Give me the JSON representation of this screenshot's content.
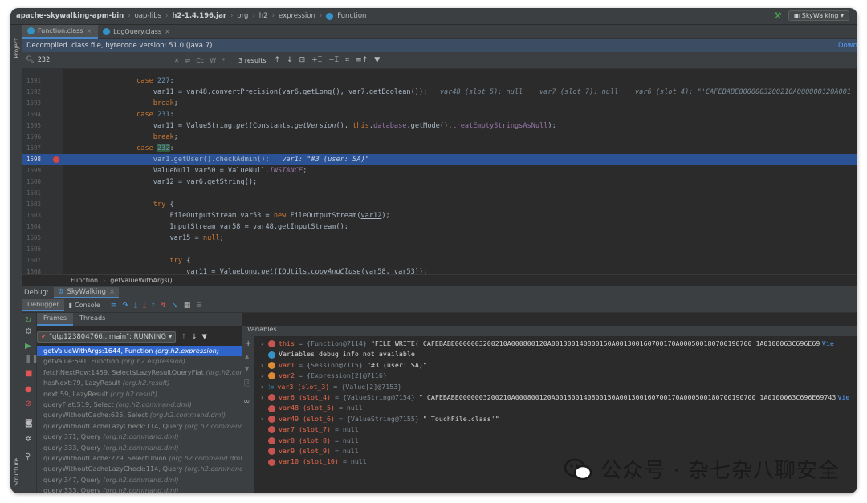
{
  "breadcrumb": [
    "apache-skywalking-apm-bin",
    "oap-libs",
    "h2-1.4.196.jar",
    "org",
    "h2",
    "expression",
    "Function"
  ],
  "run_config": "SkyWalking",
  "left_strip": {
    "project": "Project",
    "structure": "Structure"
  },
  "editor_tabs": [
    {
      "label": "Function.class",
      "active": true
    },
    {
      "label": "LogQuery.class",
      "active": false
    }
  ],
  "decompiled_notice": "Decompiled .class file, bytecode version: 51.0 (Java 7)",
  "decompiled_link": "Down",
  "find": {
    "query": "232",
    "results": "3 results",
    "opts": [
      "Cc",
      "W",
      "*"
    ]
  },
  "code": [
    {
      "ln": "1591",
      "html": "            <span class='k'>case</span> <span class='n'>227</span>:"
    },
    {
      "ln": "1592",
      "html": "                var11 = var48.<span>convertPrecision</span>(<span class='u'>var6</span>.getLong(), var7.getBoolean());   <span class='dbg'>var48 (slot_5): null    var7 (slot_7): null    var6 (slot_4): \"'CAFEBABE0000003200210A000800120A001</span>"
    },
    {
      "ln": "1593",
      "html": "                <span class='k'>break</span>;"
    },
    {
      "ln": "1594",
      "html": "            <span class='k'>case</span> <span class='n'>231</span>:"
    },
    {
      "ln": "1595",
      "html": "                var11 = ValueString.<span class='it'>get</span>(Constants.<span class='it'>getVersion</span>(), <span class='k'>this</span>.<span class='f'>database</span>.getMode().<span class='f'>treatEmptyStringsAsNull</span>);"
    },
    {
      "ln": "1596",
      "html": "                <span class='k'>break</span>;"
    },
    {
      "ln": "1597",
      "html": "            <span class='k'>case</span> <span class='n' style='background:#32593d'>232</span>:"
    },
    {
      "ln": "1598",
      "hl": true,
      "bp": true,
      "html": "                var1.getUser().checkAdmin();   <span class='dbg' style='color:#c5d2e0'>var1: \"#3 (user: SA)\"</span>"
    },
    {
      "ln": "1599",
      "html": "                ValueNull var50 = ValueNull.<span class='f it'>INSTANCE</span>;"
    },
    {
      "ln": "1600",
      "html": "                <span class='u'>var12</span> = <span class='u'>var6</span>.getString();"
    },
    {
      "ln": "1601",
      "html": ""
    },
    {
      "ln": "1602",
      "html": "                <span class='k'>try</span> {"
    },
    {
      "ln": "1603",
      "html": "                    FileOutputStream var53 = <span class='k'>new</span> FileOutputStream(<span class='u'>var12</span>);"
    },
    {
      "ln": "1604",
      "html": "                    InputStream var58 = var48.getInputStream();"
    },
    {
      "ln": "1605",
      "html": "                    <span class='u'>var15</span> = <span class='k'>null</span>;"
    },
    {
      "ln": "1606",
      "html": ""
    },
    {
      "ln": "1607",
      "html": "                    <span class='k'>try</span> {"
    },
    {
      "ln": "1608",
      "html": "                        var11 = ValueLong.<span class='it'>get</span>(IOUtils.<span class='it'>copyAndClose</span>(var58, var53));"
    }
  ],
  "code_crumbs": [
    "Function",
    "getValueWithArgs()"
  ],
  "debug": {
    "label": "Debug:",
    "session": "SkyWalking",
    "tabs": [
      "Debugger",
      "Console"
    ],
    "frames_tab": "Frames",
    "threads_tab": "Threads",
    "variables_tab": "Variables"
  },
  "thread": "\"qtp123804766...main\": RUNNING",
  "frames": [
    {
      "m": "getValueWithArgs:1644, Function",
      "p": "(org.h2.expression)",
      "sel": true
    },
    {
      "m": "getValue:591, Function",
      "p": "(org.h2.expression)"
    },
    {
      "m": "fetchNextRow:1459, Select$LazyResultQueryFlat",
      "p": "(org.h2.command.dml)"
    },
    {
      "m": "hasNext:79, LazyResult",
      "p": "(org.h2.result)"
    },
    {
      "m": "next:59, LazyResult",
      "p": "(org.h2.result)"
    },
    {
      "m": "queryFlat:519, Select",
      "p": "(org.h2.command.dml)"
    },
    {
      "m": "queryWithoutCache:625, Select",
      "p": "(org.h2.command.dml)"
    },
    {
      "m": "queryWithoutCacheLazyCheck:114, Query",
      "p": "(org.h2.command.dml)"
    },
    {
      "m": "query:371, Query",
      "p": "(org.h2.command.dml)"
    },
    {
      "m": "query:333, Query",
      "p": "(org.h2.command.dml)"
    },
    {
      "m": "queryWithoutCache:229, SelectUnion",
      "p": "(org.h2.command.dml)"
    },
    {
      "m": "queryWithoutCacheLazyCheck:114, Query",
      "p": "(org.h2.command.dml)"
    },
    {
      "m": "query:347, Query",
      "p": "(org.h2.command.dml)"
    },
    {
      "m": "query:333, Query",
      "p": "(org.h2.command.dml)"
    }
  ],
  "variables": [
    {
      "arrow": "›",
      "icon": "e",
      "name": "this",
      "type": "= {Function@7114}",
      "val": "\"FILE_WRITE('CAFEBABE0000003200210A000800120A001300140800150A001300160700170A000500180700190700 1A0100063C696E69743",
      "link": "Vie"
    },
    {
      "arrow": "",
      "icon": "info",
      "name": "",
      "type": "",
      "val": "Variables debug info not available",
      "link": ""
    },
    {
      "arrow": "›",
      "icon": "o",
      "name": "var1",
      "type": "= {Session@7115}",
      "val": "\"#3 (user: SA)\"",
      "link": ""
    },
    {
      "arrow": "›",
      "icon": "o",
      "name": "var2",
      "type": "= {Expression[2]@7116}",
      "val": "",
      "link": ""
    },
    {
      "arrow": "›",
      "icon": "arr",
      "name": "var3 (slot_3)",
      "type": "= {Value[2]@7153}",
      "val": "",
      "link": ""
    },
    {
      "arrow": "›",
      "icon": "e",
      "name": "var6 (slot_4)",
      "type": "= {ValueString@7154}",
      "val": "\"'CAFEBABE0000003200210A000800120A001300140800150A001300160700170A000500180700190700 1A0100063C696E69743",
      "link": "Vie"
    },
    {
      "arrow": "",
      "icon": "e",
      "name": "var48 (slot_5)",
      "type": "= null",
      "val": "",
      "link": ""
    },
    {
      "arrow": "›",
      "icon": "e",
      "name": "var49 (slot_6)",
      "type": "= {ValueString@7155}",
      "val": "\"'TouchFile.class'\"",
      "link": ""
    },
    {
      "arrow": "",
      "icon": "e",
      "name": "var7 (slot_7)",
      "type": "= null",
      "val": "",
      "link": ""
    },
    {
      "arrow": "",
      "icon": "e",
      "name": "var8 (slot_8)",
      "type": "= null",
      "val": "",
      "link": ""
    },
    {
      "arrow": "",
      "icon": "e",
      "name": "var9 (slot_9)",
      "type": "= null",
      "val": "",
      "link": ""
    },
    {
      "arrow": "",
      "icon": "e",
      "name": "var10 (slot_10)",
      "type": "= null",
      "val": "",
      "link": ""
    }
  ],
  "watermark": "公众号 · 杂七杂八聊安全",
  "colors": {
    "selection": "#2f65ca",
    "exec_line": "#2a5295",
    "keyword": "#cc7832",
    "var_name": "#ec6a4c"
  }
}
